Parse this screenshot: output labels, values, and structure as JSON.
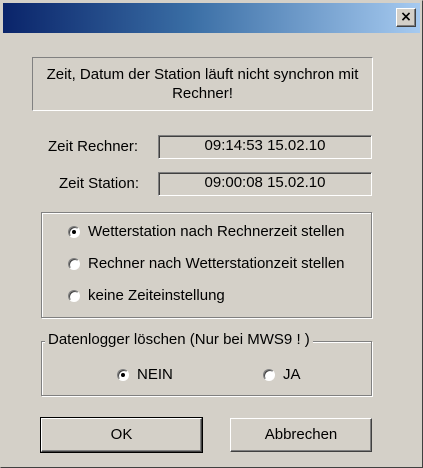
{
  "titlebar": {
    "title": "",
    "close_label": "×"
  },
  "message": "Zeit, Datum der Station läuft nicht synchron mit Rechner!",
  "time_rows": [
    {
      "label": "Zeit Rechner:",
      "value": "09:14:53  15.02.10"
    },
    {
      "label": "Zeit Station:",
      "value": "09:00:08  15.02.10"
    }
  ],
  "sync_options": [
    {
      "label": "Wetterstation nach Rechnerzeit stellen",
      "checked": true
    },
    {
      "label": "Rechner nach Wetterstationzeit stellen",
      "checked": false
    },
    {
      "label": "keine Zeiteinstellung",
      "checked": false
    }
  ],
  "datalogger": {
    "legend": "Datenlogger löschen  (Nur bei MWS9 ! )",
    "options": [
      {
        "label": "NEIN",
        "checked": true
      },
      {
        "label": "JA",
        "checked": false
      }
    ]
  },
  "buttons": {
    "ok": "OK",
    "cancel": "Abbrechen"
  },
  "colors": {
    "face": "#d4d0c8",
    "title_start": "#0a246a",
    "title_end": "#a6caf0"
  }
}
